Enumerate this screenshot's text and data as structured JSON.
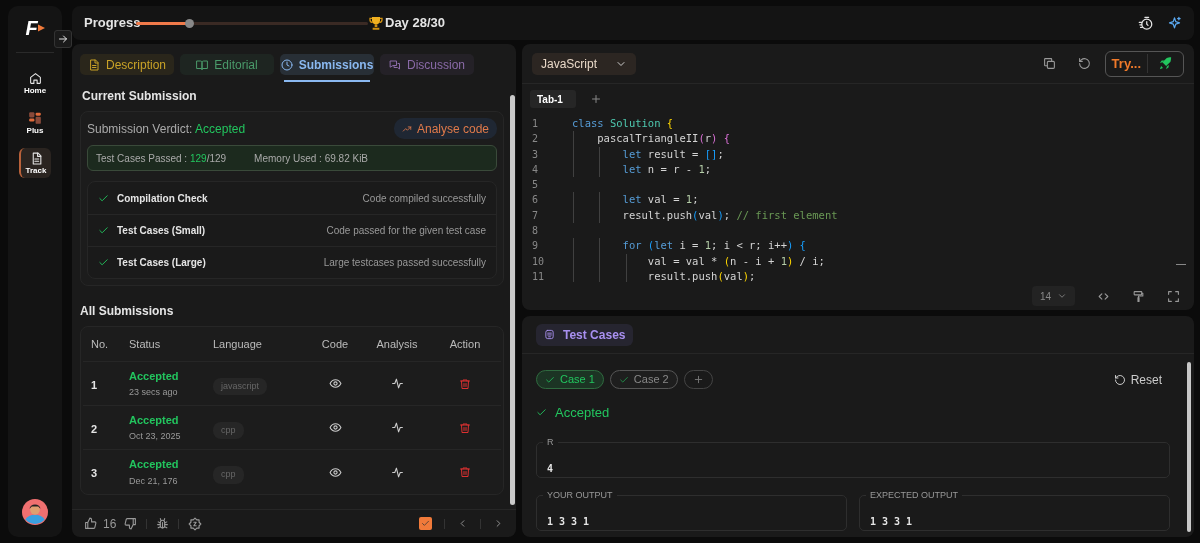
{
  "sidebar": {
    "logo": "F",
    "items": [
      {
        "label": "Home",
        "selected": false
      },
      {
        "label": "Plus",
        "selected": false
      },
      {
        "label": "Track",
        "selected": true
      }
    ]
  },
  "topbar": {
    "label": "Progress",
    "level": 0.23,
    "goal": "Day 28/30"
  },
  "left_panel": {
    "tabs": [
      {
        "label": "Description",
        "color": "#c9a227",
        "selected": false
      },
      {
        "label": "Editorial",
        "color": "#4a9a6a",
        "selected": false
      },
      {
        "label": "Submissions",
        "color": "#8ab8f0",
        "selected": true
      },
      {
        "label": "Discussion",
        "color": "#8a6aa8",
        "selected": false
      }
    ],
    "current_submission": {
      "heading": "Current Submission",
      "verdict_label": "Submission Verdict:",
      "verdict": "Accepted",
      "analyse_button": "Analyse code",
      "passed_label": "Test Cases Passed :",
      "passed": "129",
      "total": "/129",
      "memory": "Memory Used : 69.82 KiB",
      "checks": [
        {
          "title": "Compilation Check",
          "detail": "Code compiled successfully",
          "passed": true
        },
        {
          "title": "Test Cases (Small)",
          "detail": "Code passed for the given test case",
          "passed": true
        },
        {
          "title": "Test Cases (Large)",
          "detail": "Large testcases passed successfully",
          "passed": true
        }
      ]
    },
    "all_submissions": {
      "heading": "All Submissions",
      "columns": [
        "No.",
        "Status",
        "Language",
        "Code",
        "Analysis",
        "Action"
      ],
      "rows": [
        {
          "no": "1",
          "status": "Accepted",
          "time": "23 secs ago",
          "language": "javascript"
        },
        {
          "no": "2",
          "status": "Accepted",
          "time": "Oct 23, 2025",
          "language": "cpp"
        },
        {
          "no": "3",
          "status": "Accepted",
          "time": "Dec 21, 176",
          "language": "cpp"
        }
      ]
    },
    "footer": {
      "likes": "16",
      "checked": true
    }
  },
  "editor": {
    "language": "JavaScript",
    "try_button": "Try...",
    "tabs": [
      {
        "label": "Tab-1",
        "selected": true
      }
    ],
    "font_size": "14",
    "lines": [
      {
        "number": "1",
        "tokens": [
          {
            "text": "class ",
            "kind": "keyword"
          },
          {
            "text": "Solution ",
            "kind": "class"
          },
          {
            "text": "{",
            "kind": "bracket1"
          }
        ]
      },
      {
        "number": "2",
        "tokens": [
          {
            "text": "    pascalTriangleII",
            "kind": "plain"
          },
          {
            "text": "(",
            "kind": "bracket2"
          },
          {
            "text": "r",
            "kind": "plain"
          },
          {
            "text": ") ",
            "kind": "bracket2"
          },
          {
            "text": "{",
            "kind": "bracket2"
          }
        ]
      },
      {
        "number": "3",
        "tokens": [
          {
            "text": "        let",
            "kind": "keyword"
          },
          {
            "text": " result = ",
            "kind": "plain"
          },
          {
            "text": "[]",
            "kind": "bracket3"
          },
          {
            "text": ";",
            "kind": "plain"
          }
        ]
      },
      {
        "number": "4",
        "tokens": [
          {
            "text": "        let",
            "kind": "keyword"
          },
          {
            "text": " n = r - ",
            "kind": "plain"
          },
          {
            "text": "1",
            "kind": "number"
          },
          {
            "text": ";",
            "kind": "plain"
          }
        ]
      },
      {
        "number": "5"
      },
      {
        "number": "6",
        "tokens": [
          {
            "text": "        let",
            "kind": "keyword"
          },
          {
            "text": " val = ",
            "kind": "plain"
          },
          {
            "text": "1",
            "kind": "number"
          },
          {
            "text": ";",
            "kind": "plain"
          }
        ]
      },
      {
        "number": "7",
        "tokens": [
          {
            "text": "        result.push",
            "kind": "plain"
          },
          {
            "text": "(",
            "kind": "bracket3"
          },
          {
            "text": "val",
            "kind": "plain"
          },
          {
            "text": ")",
            "kind": "bracket3"
          },
          {
            "text": "; ",
            "kind": "plain"
          },
          {
            "text": "// first element",
            "kind": "comment"
          }
        ]
      },
      {
        "number": "8"
      },
      {
        "number": "9",
        "tokens": [
          {
            "text": "        for ",
            "kind": "keyword"
          },
          {
            "text": "(",
            "kind": "bracket3"
          },
          {
            "text": "let",
            "kind": "keyword"
          },
          {
            "text": " i = ",
            "kind": "plain"
          },
          {
            "text": "1",
            "kind": "number"
          },
          {
            "text": "; i < r; i++",
            "kind": "plain"
          },
          {
            "text": ") ",
            "kind": "bracket3"
          },
          {
            "text": "{",
            "kind": "bracket3"
          }
        ]
      },
      {
        "number": "10",
        "tokens": [
          {
            "text": "            val = val * ",
            "kind": "plain"
          },
          {
            "text": "(",
            "kind": "bracket1"
          },
          {
            "text": "n - i + ",
            "kind": "plain"
          },
          {
            "text": "1",
            "kind": "number"
          },
          {
            "text": ")",
            "kind": "bracket1"
          },
          {
            "text": " / i;",
            "kind": "plain"
          }
        ]
      },
      {
        "number": "11",
        "tokens": [
          {
            "text": "            result.push",
            "kind": "plain"
          },
          {
            "text": "(",
            "kind": "bracket1"
          },
          {
            "text": "val",
            "kind": "plain"
          },
          {
            "text": ")",
            "kind": "bracket1"
          },
          {
            "text": ";",
            "kind": "plain"
          }
        ]
      }
    ]
  },
  "test_panel": {
    "tab": "Test Cases",
    "cases": [
      {
        "label": "Case 1",
        "passed": true,
        "selected": true
      },
      {
        "label": "Case 2",
        "passed": true,
        "selected": false
      }
    ],
    "reset": "Reset",
    "result": "Accepted",
    "input": {
      "label": "R",
      "value": "4"
    },
    "your_output": {
      "label": "YOUR OUTPUT",
      "value": "1 3 3 1"
    },
    "expected_output": {
      "label": "EXPECTED OUTPUT",
      "value": "1 3 3 1"
    }
  }
}
